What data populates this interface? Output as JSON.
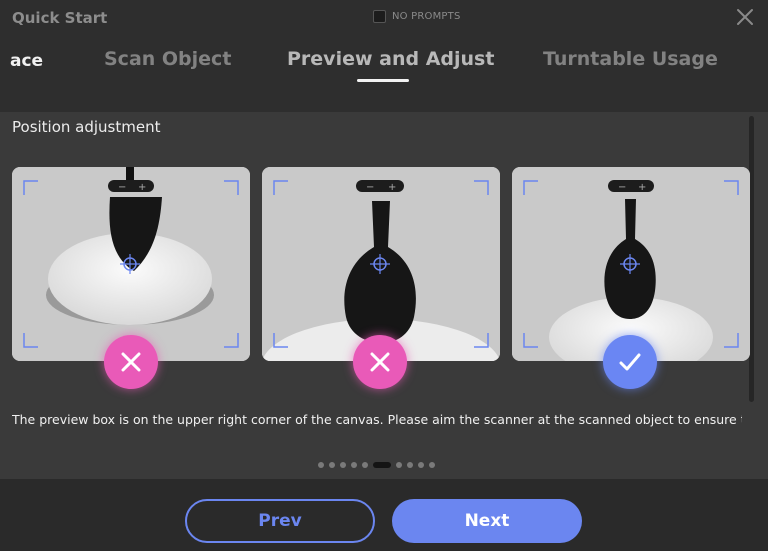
{
  "header": {
    "title": "Quick Start",
    "no_prompts_label": "NO PROMPTS",
    "tabs": [
      {
        "label": "ace",
        "active": false
      },
      {
        "label": "Scan Object",
        "active": false
      },
      {
        "label": "Preview and Adjust",
        "active": true
      },
      {
        "label": "Turntable Usage",
        "active": false
      }
    ]
  },
  "content": {
    "section_title": "Position adjustment",
    "cards": [
      {
        "name": "card-too-high",
        "result": "incorrect",
        "icon": "cross-icon"
      },
      {
        "name": "card-too-close",
        "result": "incorrect",
        "icon": "cross-icon"
      },
      {
        "name": "card-correct",
        "result": "correct",
        "icon": "check-icon"
      }
    ],
    "description": "The preview box is on the upper right corner of the canvas. Please aim the scanner at the scanned object to ensure that",
    "pagination": {
      "total": 11,
      "current": 6
    }
  },
  "footer": {
    "prev_label": "Prev",
    "next_label": "Next"
  },
  "colors": {
    "accent": "#6b86f0",
    "incorrect": "#e95ab8",
    "correct": "#6a86f3"
  }
}
